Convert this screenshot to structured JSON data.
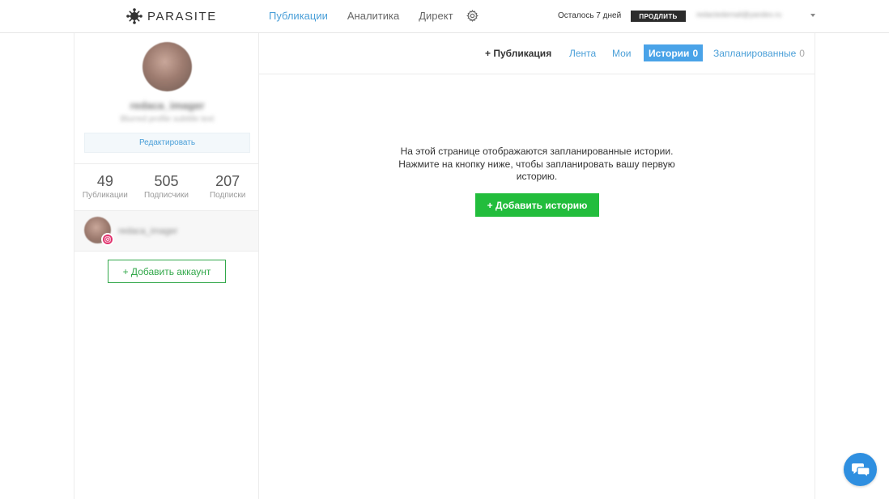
{
  "app": {
    "logo_text": "PARASITE"
  },
  "nav": {
    "items": [
      {
        "label": "Публикации",
        "active": true
      },
      {
        "label": "Аналитика",
        "active": false
      },
      {
        "label": "Директ",
        "active": false
      }
    ],
    "settings_icon": "gear-icon"
  },
  "account_bar": {
    "trial_text": "Осталось 7 дней",
    "renew_label": "ПРОДЛИТЬ",
    "email": "redactedemail@yandex.ru"
  },
  "profile": {
    "name": "redaca_imager",
    "subtitle": "Blurred profile subtitle text",
    "edit_label": "Редактировать",
    "stats": [
      {
        "value": "49",
        "label": "Публикации"
      },
      {
        "value": "505",
        "label": "Подписчики"
      },
      {
        "value": "207",
        "label": "Подписки"
      }
    ],
    "account_name": "redaca_imager",
    "add_account_label": "+ Добавить аккаунт"
  },
  "tabs": {
    "new_post": "+ Публикация",
    "feed": "Лента",
    "mine": "Мои",
    "stories": "Истории",
    "stories_count": "0",
    "scheduled": "Запланированные",
    "scheduled_count": "0",
    "active": "stories"
  },
  "main": {
    "empty_message": "На этой странице отображаются запланированные истории. Нажмите на кнопку ниже, чтобы запланировать вашу первую историю.",
    "add_story_label": "+ Добавить историю"
  },
  "colors": {
    "accent": "#4a9fd8",
    "active_tab": "#4aa3e8",
    "success": "#22bd3c",
    "outline_green": "#32a84a",
    "chat": "#2f8fe0"
  }
}
